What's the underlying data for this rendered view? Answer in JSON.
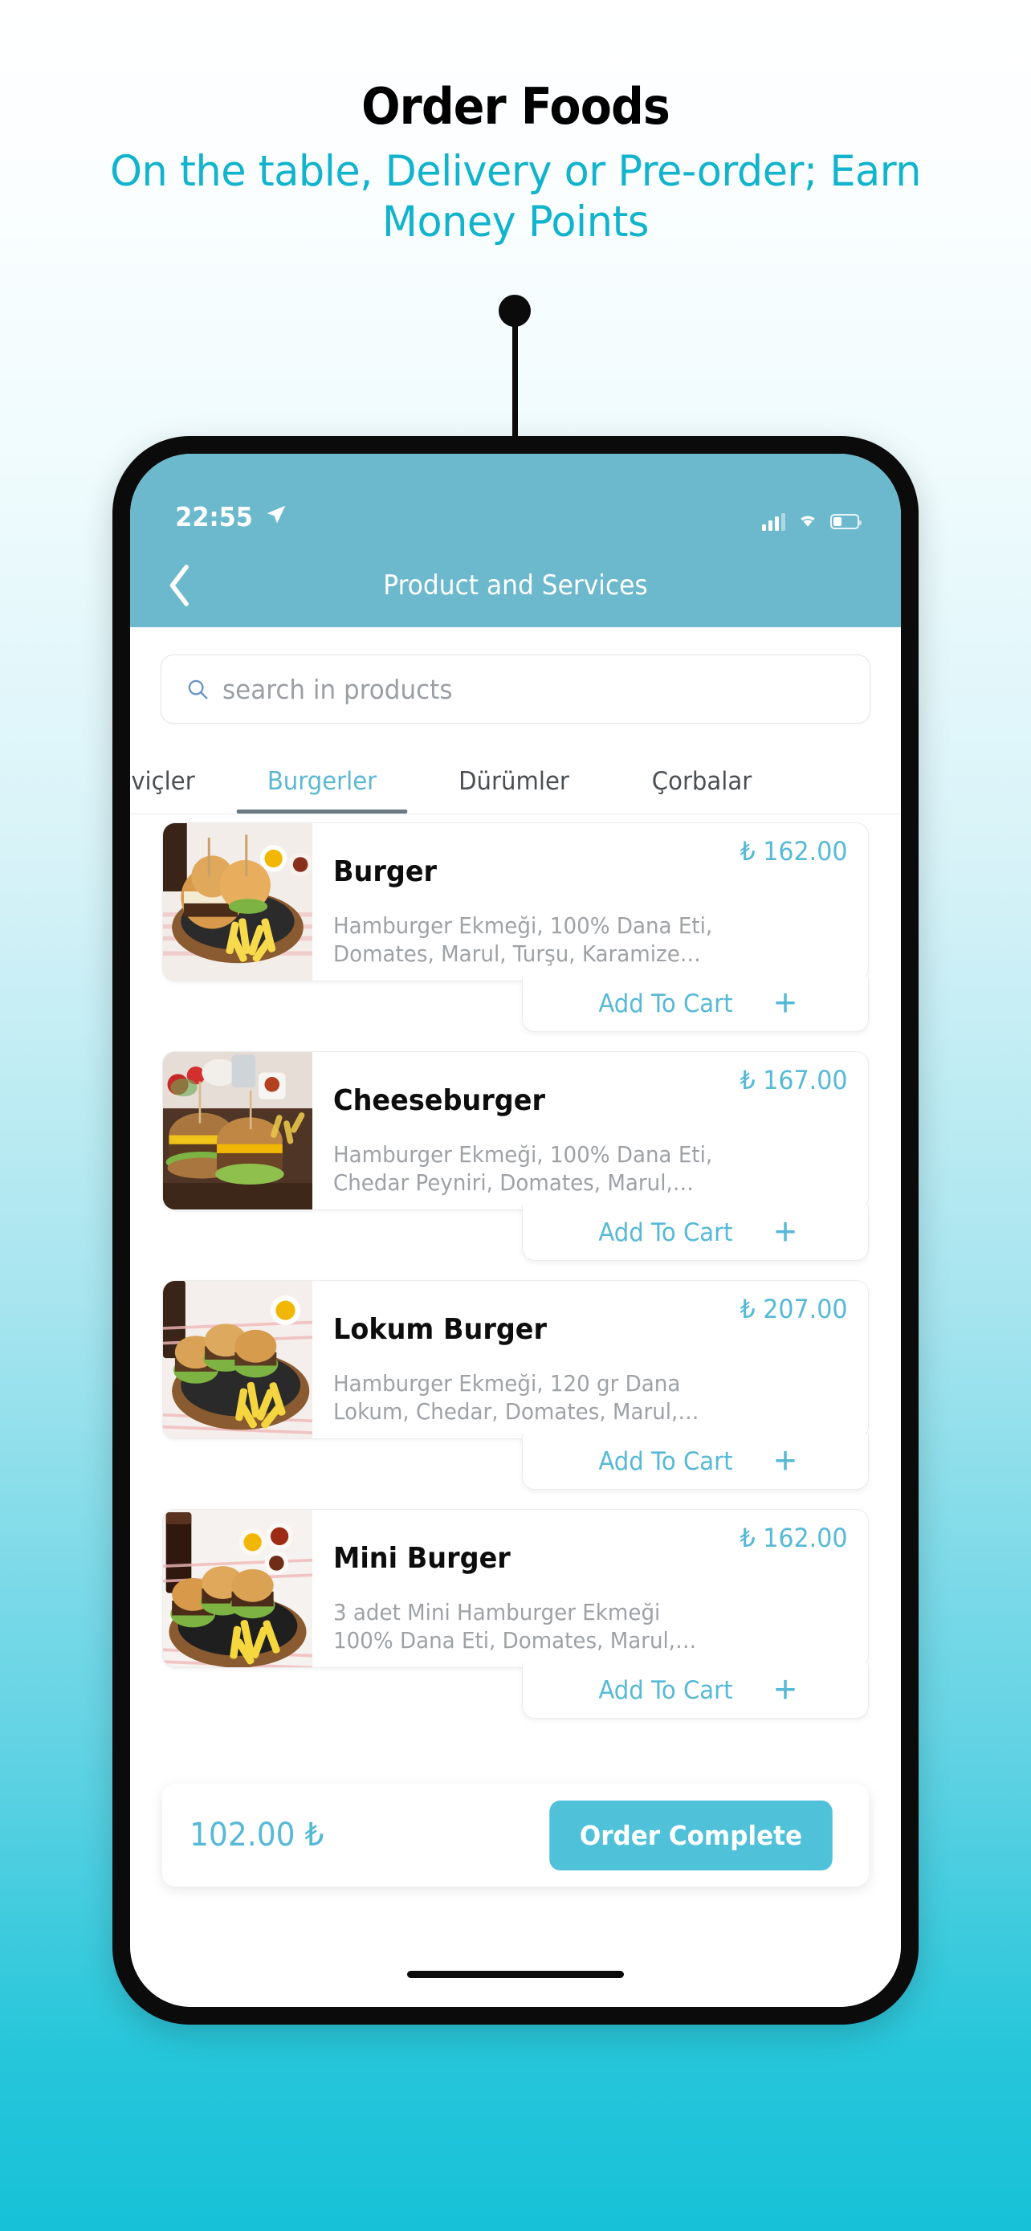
{
  "promo": {
    "title": "Order Foods",
    "subtitle": "On the table, Delivery or Pre-order; Earn Money Points",
    "accent_color": "#12b3cc"
  },
  "statusbar": {
    "time": "22:55",
    "location_icon": "location-arrow-icon",
    "signal_icon": "cellular-bars-icon",
    "wifi_icon": "wifi-icon",
    "battery_icon": "battery-low-icon"
  },
  "navbar": {
    "back_icon": "chevron-left-icon",
    "title": "Product and Services",
    "bg_color": "#6cb9ce"
  },
  "search": {
    "icon": "search-icon",
    "placeholder": "search in products",
    "value": ""
  },
  "tabs": {
    "active_index": 1,
    "items": [
      {
        "label": "viçler"
      },
      {
        "label": "Burgerler"
      },
      {
        "label": "Dürümler"
      },
      {
        "label": "Çorbalar"
      }
    ]
  },
  "products": [
    {
      "name": "Burger",
      "price": "₺ 162.00",
      "description": "Hamburger Ekmeği, 100% Dana Eti,\nDomates, Marul, Turşu, Karamize…",
      "add_label": "Add To Cart",
      "add_icon": "plus-icon",
      "image": "burger-photo"
    },
    {
      "name": "Cheeseburger",
      "price": "₺ 167.00",
      "description": "Hamburger Ekmeği, 100% Dana Eti,\nChedar Peyniri, Domates, Marul,…",
      "add_label": "Add To Cart",
      "add_icon": "plus-icon",
      "image": "cheeseburger-photo"
    },
    {
      "name": "Lokum Burger",
      "price": "₺ 207.00",
      "description": "Hamburger Ekmeği, 120 gr Dana\nLokum, Chedar, Domates, Marul,…",
      "add_label": "Add To Cart",
      "add_icon": "plus-icon",
      "image": "lokum-burger-photo"
    },
    {
      "name": "Mini Burger",
      "price": "₺ 162.00",
      "description": "3 adet Mini Hamburger Ekmeği\n100% Dana Eti, Domates, Marul,…",
      "add_label": "Add To Cart",
      "add_icon": "plus-icon",
      "image": "mini-burger-photo"
    }
  ],
  "cart": {
    "total": "102.00 ₺",
    "button_label": "Order Complete",
    "button_color": "#4fc1d8"
  },
  "theme": {
    "accent": "#56b9d6",
    "header_bg": "#6cb9ce",
    "page_gradient_top": "#ffffff",
    "page_gradient_bottom": "#17c1d8"
  }
}
